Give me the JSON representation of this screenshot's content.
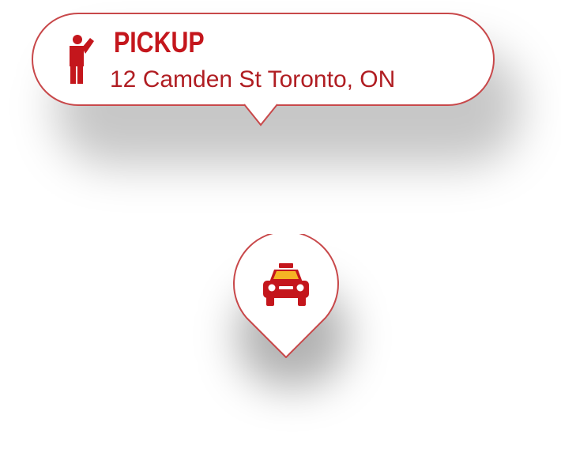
{
  "pickup_callout": {
    "title": "PICKUP",
    "address": "12 Camden St Toronto, ON",
    "icon": "person-hailing-icon"
  },
  "map_pin": {
    "icon": "taxi-icon"
  },
  "colors": {
    "brand_red": "#c4161c",
    "border_red": "#c8484a",
    "taxi_sign_yellow": "#f5b324"
  }
}
